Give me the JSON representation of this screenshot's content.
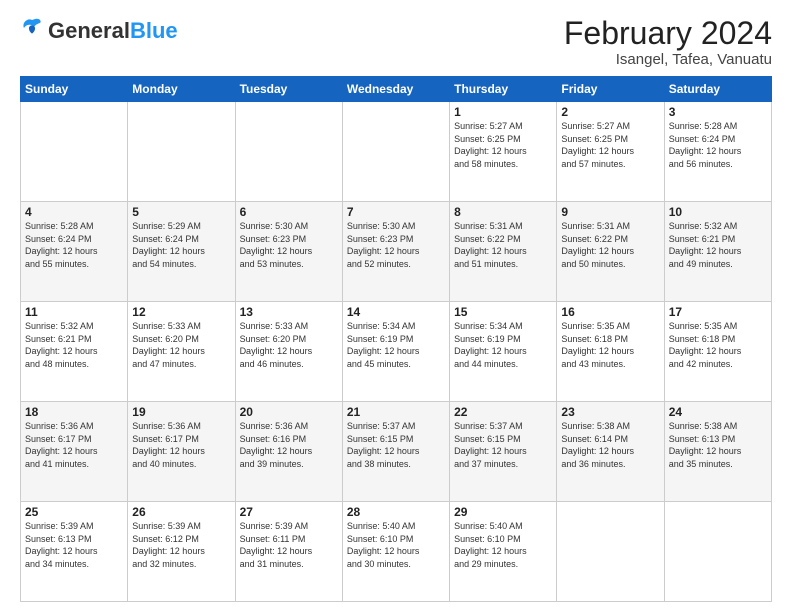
{
  "header": {
    "logo": {
      "general": "General",
      "blue": "Blue"
    },
    "title": "February 2024",
    "location": "Isangel, Tafea, Vanuatu"
  },
  "days_of_week": [
    "Sunday",
    "Monday",
    "Tuesday",
    "Wednesday",
    "Thursday",
    "Friday",
    "Saturday"
  ],
  "weeks": [
    [
      {
        "day": "",
        "info": ""
      },
      {
        "day": "",
        "info": ""
      },
      {
        "day": "",
        "info": ""
      },
      {
        "day": "",
        "info": ""
      },
      {
        "day": "1",
        "info": "Sunrise: 5:27 AM\nSunset: 6:25 PM\nDaylight: 12 hours\nand 58 minutes."
      },
      {
        "day": "2",
        "info": "Sunrise: 5:27 AM\nSunset: 6:25 PM\nDaylight: 12 hours\nand 57 minutes."
      },
      {
        "day": "3",
        "info": "Sunrise: 5:28 AM\nSunset: 6:24 PM\nDaylight: 12 hours\nand 56 minutes."
      }
    ],
    [
      {
        "day": "4",
        "info": "Sunrise: 5:28 AM\nSunset: 6:24 PM\nDaylight: 12 hours\nand 55 minutes."
      },
      {
        "day": "5",
        "info": "Sunrise: 5:29 AM\nSunset: 6:24 PM\nDaylight: 12 hours\nand 54 minutes."
      },
      {
        "day": "6",
        "info": "Sunrise: 5:30 AM\nSunset: 6:23 PM\nDaylight: 12 hours\nand 53 minutes."
      },
      {
        "day": "7",
        "info": "Sunrise: 5:30 AM\nSunset: 6:23 PM\nDaylight: 12 hours\nand 52 minutes."
      },
      {
        "day": "8",
        "info": "Sunrise: 5:31 AM\nSunset: 6:22 PM\nDaylight: 12 hours\nand 51 minutes."
      },
      {
        "day": "9",
        "info": "Sunrise: 5:31 AM\nSunset: 6:22 PM\nDaylight: 12 hours\nand 50 minutes."
      },
      {
        "day": "10",
        "info": "Sunrise: 5:32 AM\nSunset: 6:21 PM\nDaylight: 12 hours\nand 49 minutes."
      }
    ],
    [
      {
        "day": "11",
        "info": "Sunrise: 5:32 AM\nSunset: 6:21 PM\nDaylight: 12 hours\nand 48 minutes."
      },
      {
        "day": "12",
        "info": "Sunrise: 5:33 AM\nSunset: 6:20 PM\nDaylight: 12 hours\nand 47 minutes."
      },
      {
        "day": "13",
        "info": "Sunrise: 5:33 AM\nSunset: 6:20 PM\nDaylight: 12 hours\nand 46 minutes."
      },
      {
        "day": "14",
        "info": "Sunrise: 5:34 AM\nSunset: 6:19 PM\nDaylight: 12 hours\nand 45 minutes."
      },
      {
        "day": "15",
        "info": "Sunrise: 5:34 AM\nSunset: 6:19 PM\nDaylight: 12 hours\nand 44 minutes."
      },
      {
        "day": "16",
        "info": "Sunrise: 5:35 AM\nSunset: 6:18 PM\nDaylight: 12 hours\nand 43 minutes."
      },
      {
        "day": "17",
        "info": "Sunrise: 5:35 AM\nSunset: 6:18 PM\nDaylight: 12 hours\nand 42 minutes."
      }
    ],
    [
      {
        "day": "18",
        "info": "Sunrise: 5:36 AM\nSunset: 6:17 PM\nDaylight: 12 hours\nand 41 minutes."
      },
      {
        "day": "19",
        "info": "Sunrise: 5:36 AM\nSunset: 6:17 PM\nDaylight: 12 hours\nand 40 minutes."
      },
      {
        "day": "20",
        "info": "Sunrise: 5:36 AM\nSunset: 6:16 PM\nDaylight: 12 hours\nand 39 minutes."
      },
      {
        "day": "21",
        "info": "Sunrise: 5:37 AM\nSunset: 6:15 PM\nDaylight: 12 hours\nand 38 minutes."
      },
      {
        "day": "22",
        "info": "Sunrise: 5:37 AM\nSunset: 6:15 PM\nDaylight: 12 hours\nand 37 minutes."
      },
      {
        "day": "23",
        "info": "Sunrise: 5:38 AM\nSunset: 6:14 PM\nDaylight: 12 hours\nand 36 minutes."
      },
      {
        "day": "24",
        "info": "Sunrise: 5:38 AM\nSunset: 6:13 PM\nDaylight: 12 hours\nand 35 minutes."
      }
    ],
    [
      {
        "day": "25",
        "info": "Sunrise: 5:39 AM\nSunset: 6:13 PM\nDaylight: 12 hours\nand 34 minutes."
      },
      {
        "day": "26",
        "info": "Sunrise: 5:39 AM\nSunset: 6:12 PM\nDaylight: 12 hours\nand 32 minutes."
      },
      {
        "day": "27",
        "info": "Sunrise: 5:39 AM\nSunset: 6:11 PM\nDaylight: 12 hours\nand 31 minutes."
      },
      {
        "day": "28",
        "info": "Sunrise: 5:40 AM\nSunset: 6:10 PM\nDaylight: 12 hours\nand 30 minutes."
      },
      {
        "day": "29",
        "info": "Sunrise: 5:40 AM\nSunset: 6:10 PM\nDaylight: 12 hours\nand 29 minutes."
      },
      {
        "day": "",
        "info": ""
      },
      {
        "day": "",
        "info": ""
      }
    ]
  ]
}
